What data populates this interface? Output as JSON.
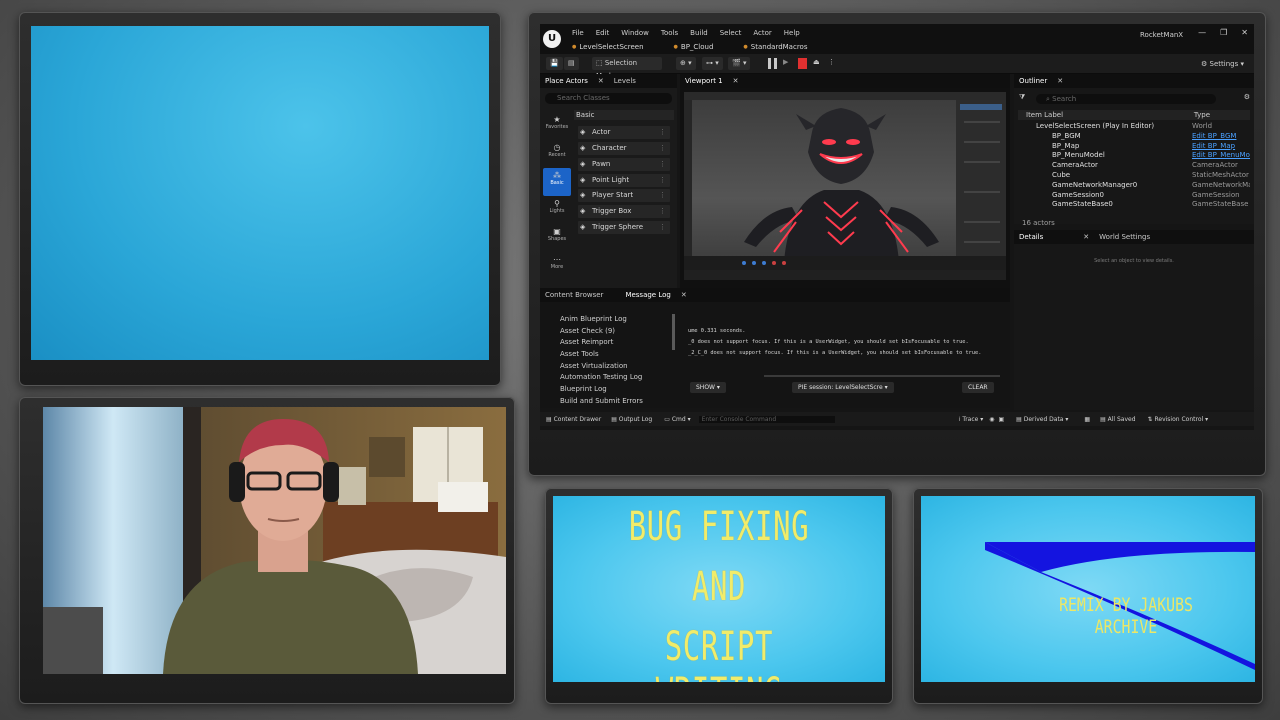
{
  "editor": {
    "menu": [
      "File",
      "Edit",
      "Window",
      "Tools",
      "Build",
      "Select",
      "Actor",
      "Help"
    ],
    "doc_tabs": [
      "LevelSelectScreen",
      "BP_Cloud",
      "StandardMacros"
    ],
    "project_name": "RocketManX",
    "window_buttons": [
      "—",
      "❐",
      "✕"
    ],
    "selection_mode": "Selection Mode",
    "settings": "Settings",
    "place_actors": {
      "tab": "Place Actors",
      "tab2": "Levels",
      "search_placeholder": "Search Classes",
      "categories": [
        "Favorites",
        "Recent",
        "Basic",
        "Lights",
        "Shapes",
        "More"
      ],
      "section": "Basic",
      "items": [
        "Actor",
        "Character",
        "Pawn",
        "Point Light",
        "Player Start",
        "Trigger Box",
        "Trigger Sphere"
      ]
    },
    "viewport": {
      "tab": "Viewport 1"
    },
    "outliner": {
      "tab": "Outliner",
      "search_placeholder": "Search",
      "col_label": "Item Label",
      "col_type": "Type",
      "rows": [
        {
          "name": "LevelSelectScreen (Play In Editor)",
          "type": "World",
          "link": false
        },
        {
          "name": "BP_BGM",
          "type": "Edit BP_BGM",
          "link": true
        },
        {
          "name": "BP_Map",
          "type": "Edit BP_Map",
          "link": true
        },
        {
          "name": "BP_MenuModel",
          "type": "Edit BP_MenuModel",
          "link": true
        },
        {
          "name": "CameraActor",
          "type": "CameraActor",
          "link": false
        },
        {
          "name": "Cube",
          "type": "StaticMeshActor",
          "link": false
        },
        {
          "name": "GameNetworkManager0",
          "type": "GameNetworkManager",
          "link": false
        },
        {
          "name": "GameSession0",
          "type": "GameSession",
          "link": false
        },
        {
          "name": "GameStateBase0",
          "type": "GameStateBase",
          "link": false
        }
      ],
      "count": "16 actors"
    },
    "details": {
      "tab": "Details",
      "tab2": "World Settings",
      "message": "Select an object to view details."
    },
    "content": {
      "tab": "Content Browser",
      "tab2": "Message Log",
      "categories": [
        "Anim Blueprint Log",
        "Asset Check (9)",
        "Asset Reimport",
        "Asset Tools",
        "Asset Virtualization",
        "Automation Testing Log",
        "Blueprint Log",
        "Build and Submit Errors"
      ],
      "lines": [
        "ume 0.331 seconds.",
        "_0 does not support focus. If this is a UserWidget, you should set bIsFocusable to true.",
        "_2_C_0 does not support focus. If this is a UserWidget, you should set bIsFocusable to true."
      ],
      "show_btn": "SHOW",
      "pie_session": "PIE session: LevelSelectScre",
      "clear_btn": "CLEAR"
    },
    "statusbar": {
      "content_drawer": "Content Drawer",
      "output_log": "Output Log",
      "cmd": "Cmd",
      "console_placeholder": "Enter Console Command",
      "trace": "Trace",
      "derived_data": "Derived Data",
      "all_saved": "All Saved",
      "revision_control": "Revision Control"
    }
  },
  "title_card": {
    "line1": "BUG FIXING",
    "line2": "AND",
    "line3": "SCRIPT WRITING"
  },
  "remix_card": {
    "text": "REMIX BY JAKUBS ARCHIVE"
  }
}
